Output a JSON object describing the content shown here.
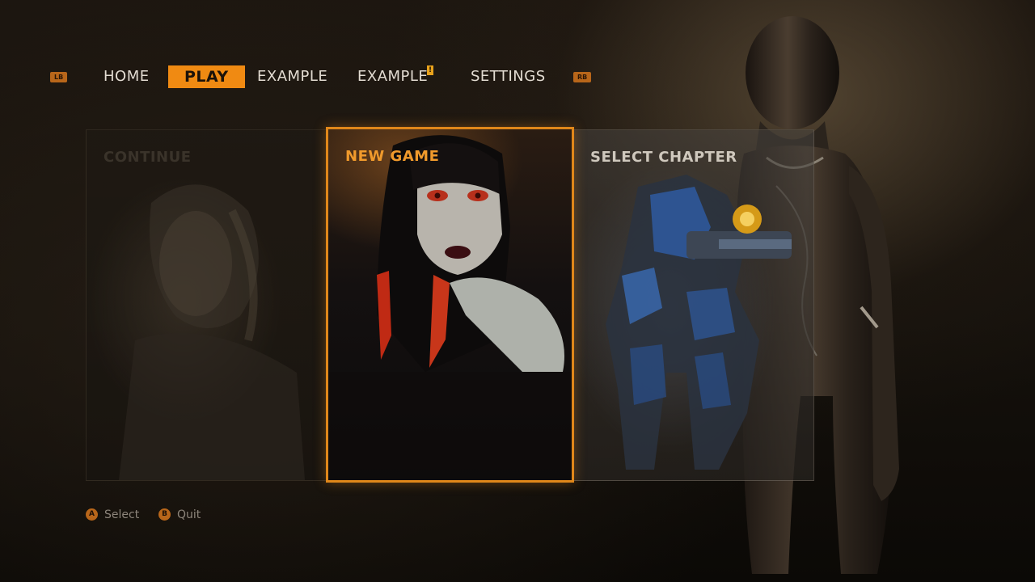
{
  "nav": {
    "left_bumper": "LB",
    "right_bumper": "RB",
    "tabs": [
      {
        "label": "HOME",
        "active": false
      },
      {
        "label": "PLAY",
        "active": true
      },
      {
        "label": "EXAMPLE",
        "active": false
      },
      {
        "label": "EXAMPLE",
        "active": false,
        "badge": "!"
      },
      {
        "label": "SETTINGS",
        "active": false
      }
    ]
  },
  "cards": [
    {
      "title": "CONTINUE",
      "state": "disabled"
    },
    {
      "title": "NEW GAME",
      "state": "selected"
    },
    {
      "title": "SELECT CHAPTER",
      "state": "available"
    }
  ],
  "footer": {
    "hints": [
      {
        "button": "A",
        "label": "Select"
      },
      {
        "button": "B",
        "label": "Quit"
      }
    ]
  },
  "colors": {
    "accent": "#f08a12",
    "selected_border": "#e0871a",
    "background": "#15110c"
  }
}
